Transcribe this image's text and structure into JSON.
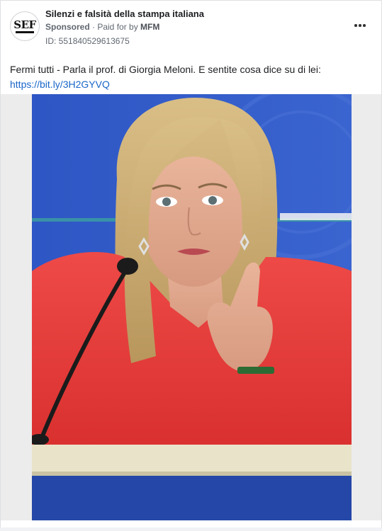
{
  "post": {
    "page_name": "Silenzi e falsità della stampa italiana",
    "avatar_text": "SEF",
    "sponsored_label": "Sponsored",
    "paid_for_prefix": " · Paid for by ",
    "paid_for_by": "MFM",
    "id_text": "ID: 551840529613675",
    "body_text": "Fermi tutti - Parla il prof. di Giorgia Meloni. E sentite cosa dice su di lei:",
    "link_text": "https://bit.ly/3H2GYVQ",
    "more_icon": "more-horizontal-icon"
  },
  "colors": {
    "link": "#1a66c8",
    "backdrop_blue": "#2f55b8",
    "jacket_red": "#e43a3a",
    "podium": "#e9e4c9"
  }
}
